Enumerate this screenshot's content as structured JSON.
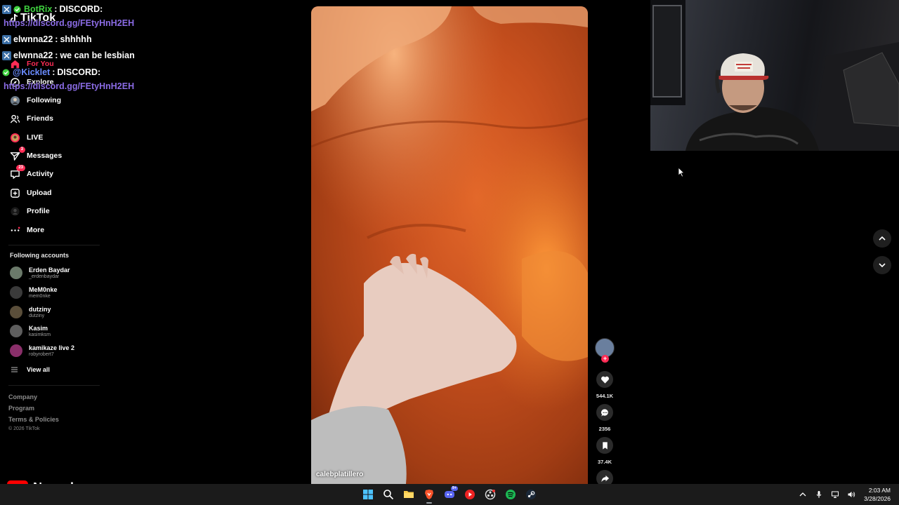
{
  "app": {
    "logo_text": "TikTok"
  },
  "nav": [
    {
      "label": "For You",
      "icon": "home-icon",
      "active": true
    },
    {
      "label": "Explore",
      "icon": "compass-icon"
    },
    {
      "label": "Following",
      "icon": "following-avatar-icon"
    },
    {
      "label": "Friends",
      "icon": "friends-icon"
    },
    {
      "label": "LIVE",
      "icon": "live-icon"
    },
    {
      "label": "Messages",
      "icon": "messages-icon",
      "badge": "3"
    },
    {
      "label": "Activity",
      "icon": "activity-icon",
      "badge": "23"
    },
    {
      "label": "Upload",
      "icon": "upload-icon"
    },
    {
      "label": "Profile",
      "icon": "profile-icon"
    },
    {
      "label": "More",
      "icon": "more-icon"
    }
  ],
  "following_accounts": {
    "title": "Following accounts",
    "accounts": [
      {
        "display": "Erden Baydar",
        "username": "_erdenbaydar",
        "color": "#6b7a6a"
      },
      {
        "display": "MeM0nke",
        "username": "mem0nke",
        "color": "#3a3a3a"
      },
      {
        "display": "dutziny",
        "username": "dutziny",
        "color": "#5a4e3a"
      },
      {
        "display": "Kasim",
        "username": "kasimksm",
        "color": "#5e5e5e"
      },
      {
        "display": "kamikaze live 2",
        "username": "robyrobert7",
        "color": "#8a2f6a"
      }
    ],
    "view_all": "View all"
  },
  "footer": {
    "links": [
      "Company",
      "Program",
      "Terms & Policies"
    ],
    "copyright": "© 2026 TikTok"
  },
  "chat": [
    {
      "user": "BotRix",
      "message": "DISCORD:",
      "user_color": "#3fd13f",
      "platform": "twitch-icon",
      "verified": true
    },
    {
      "link": "https://discord.gg/FEtyHnH2EH"
    },
    {
      "user": "elwnna22",
      "message": "shhhhh",
      "user_color": "#ffffff",
      "platform": "twitch-icon"
    },
    {
      "user": "elwnna22",
      "message": "we can be lesbian",
      "user_color": "#ffffff",
      "platform": "twitch-icon"
    },
    {
      "user": "@Kicklet",
      "message": "DISCORD:",
      "user_color": "#6a8cff",
      "platform": "kick-icon",
      "verified": true
    },
    {
      "link": "https://discord.gg/FEtyHnH2EH"
    }
  ],
  "video": {
    "author": "calebplatillero",
    "likes": "544.1K",
    "comments": "2356",
    "saves": "37.4K"
  },
  "channel": {
    "name": "Navashy",
    "icon": "youtube-icon"
  },
  "taskbar": {
    "apps": [
      {
        "name": "windows-start-icon"
      },
      {
        "name": "search-icon"
      },
      {
        "name": "file-explorer-icon"
      },
      {
        "name": "brave-browser-icon",
        "active": true
      },
      {
        "name": "discord-icon",
        "badge": "9+"
      },
      {
        "name": "youtube-music-icon"
      },
      {
        "name": "obs-icon"
      },
      {
        "name": "spotify-icon"
      },
      {
        "name": "steam-icon"
      }
    ],
    "time": "2:03 AM",
    "date": "3/28/2026"
  },
  "colors": {
    "accent": "#fe2c55",
    "chat_link": "#8a6be4",
    "background": "#000000"
  }
}
